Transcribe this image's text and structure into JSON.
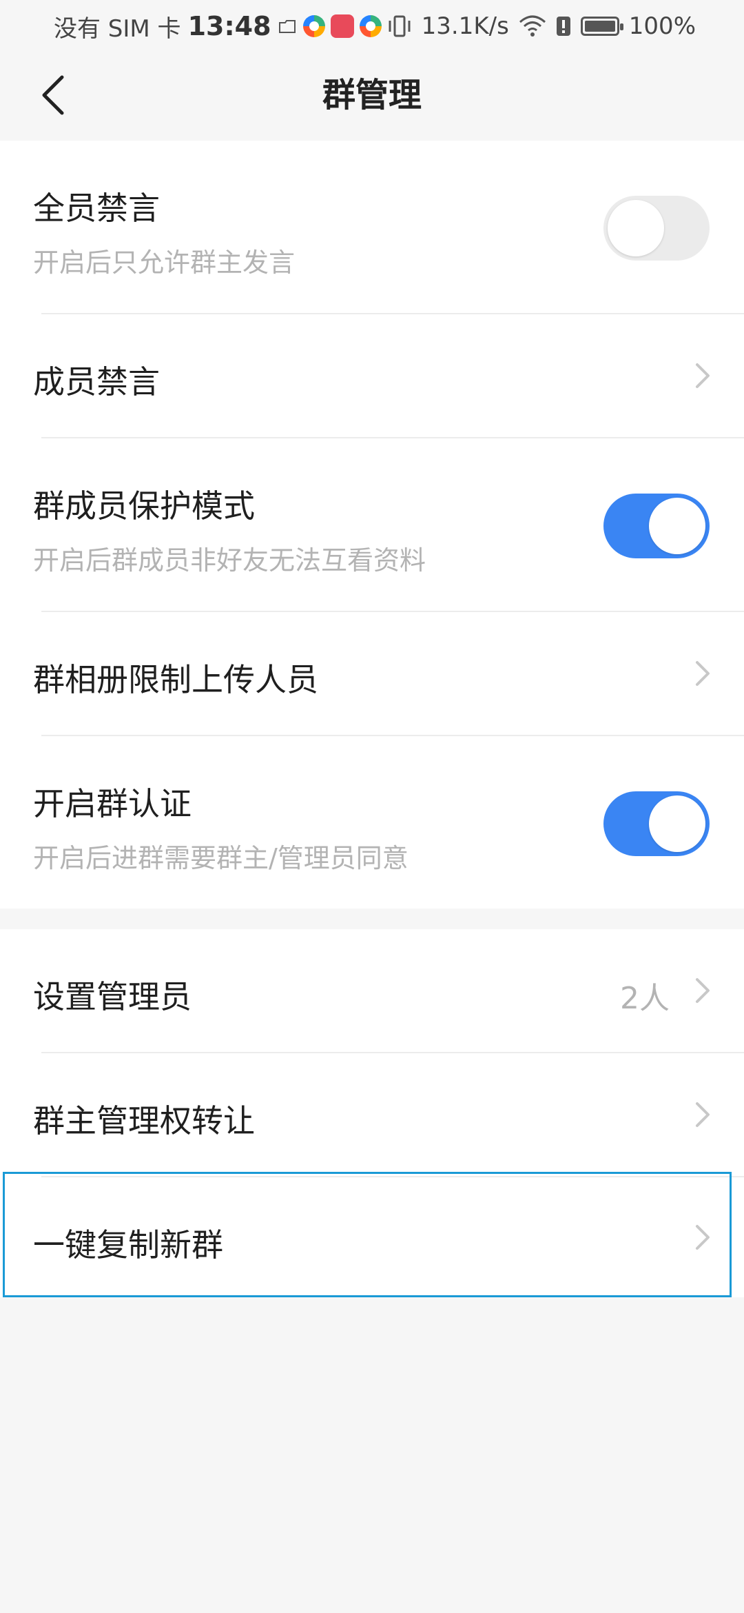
{
  "status_bar": {
    "carrier": "没有 SIM 卡",
    "time": "13:48",
    "network_speed": "13.1K/s",
    "battery": "100%"
  },
  "header": {
    "title": "群管理"
  },
  "settings": {
    "mute_all": {
      "label": "全员禁言",
      "description": "开启后只允许群主发言",
      "enabled": false
    },
    "member_mute": {
      "label": "成员禁言"
    },
    "protection_mode": {
      "label": "群成员保护模式",
      "description": "开启后群成员非好友无法互看资料",
      "enabled": true
    },
    "album_upload_limit": {
      "label": "群相册限制上传人员"
    },
    "group_verification": {
      "label": "开启群认证",
      "description": "开启后进群需要群主/管理员同意",
      "enabled": true
    },
    "set_admins": {
      "label": "设置管理员",
      "value": "2人"
    },
    "transfer_ownership": {
      "label": "群主管理权转让"
    },
    "copy_group": {
      "label": "一键复制新群"
    }
  },
  "colors": {
    "toggle_on": "#3a85f3",
    "toggle_off": "#ebebeb",
    "highlight_border": "#1a9ad6"
  }
}
